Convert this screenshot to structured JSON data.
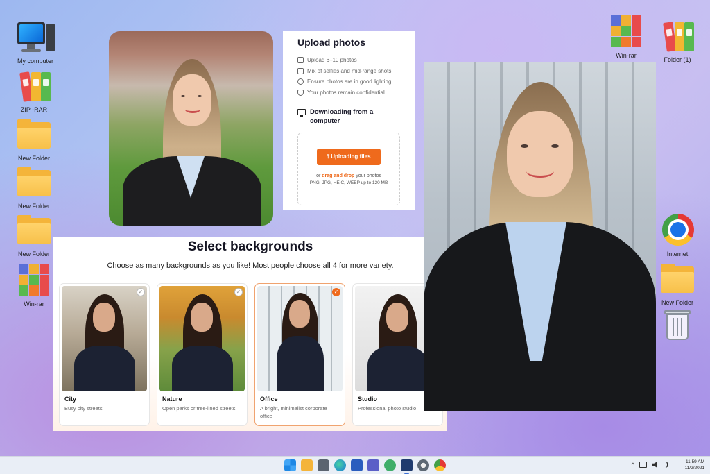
{
  "desktop": {
    "left_icons": [
      {
        "label": "My computer"
      },
      {
        "label": "ZIP -RAR"
      },
      {
        "label": "New Folder"
      },
      {
        "label": "New Folder"
      },
      {
        "label": "New Folder"
      },
      {
        "label": "Win-rar"
      }
    ],
    "right_icons": [
      {
        "label": "Win-rar"
      },
      {
        "label": "Folder (1)"
      },
      {
        "label": "Internet"
      },
      {
        "label": "New Folder"
      },
      {
        "label": "Recycle Bin",
        "hidden_label": true
      }
    ]
  },
  "upload": {
    "title": "Upload photos",
    "tips": [
      "Upload 6–10 photos",
      "Mix of selfies and mid-range shots",
      "Ensure photos are in good lighting",
      "Your photos remain confidential."
    ],
    "download_title": "Downloading from a computer",
    "button_label": "Uploading files",
    "drop_prefix": "or ",
    "drop_link": "drag and drop",
    "drop_suffix": " your photos",
    "formats": "PNG, JPG, HEIC, WEBP up to 120 MB"
  },
  "backgrounds": {
    "title": "Select backgrounds",
    "subtitle": "Choose as many backgrounds as you like! Most people choose all 4 for more variety.",
    "cards": [
      {
        "name": "City",
        "desc": "Busy city streets",
        "selected": false
      },
      {
        "name": "Nature",
        "desc": "Open parks or tree-lined streets",
        "selected": false
      },
      {
        "name": "Office",
        "desc": "A bright, minimalist corporate office",
        "selected": true
      },
      {
        "name": "Studio",
        "desc": "Professional photo studio",
        "selected": false
      }
    ],
    "check_mark": "✓"
  },
  "taskbar": {
    "tray_chevron": "^",
    "clock_time": "11:59 AM",
    "clock_date": "11/2/2021"
  },
  "colors": {
    "accent": "#ef6a1c",
    "taskbar": "#e9eef6"
  }
}
